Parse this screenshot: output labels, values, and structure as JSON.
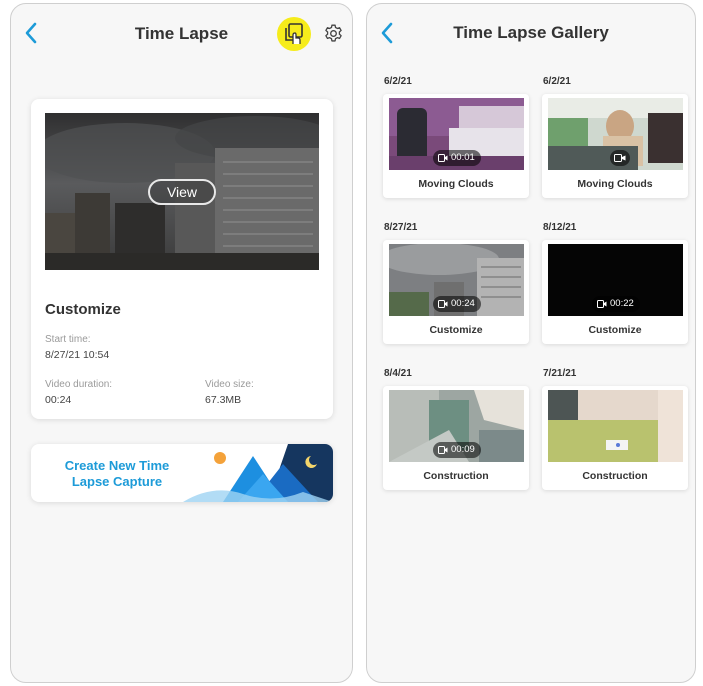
{
  "left_screen": {
    "title": "Time Lapse",
    "back_icon": "chevron-left-icon",
    "gallery_icon": "gallery-icon",
    "settings_icon": "gear-icon",
    "accent_color": "#1d9bd8",
    "highlight_color": "#f6ec1b",
    "card": {
      "view_label": "View",
      "title": "Customize",
      "start_time_label": "Start time:",
      "start_time_value": "8/27/21 10:54",
      "duration_label": "Video duration:",
      "duration_value": "00:24",
      "size_label": "Video size:",
      "size_value": "67.3MB"
    },
    "banner_label": "Create New Time Lapse Capture"
  },
  "right_screen": {
    "title": "Time Lapse Gallery",
    "back_icon": "chevron-left-icon",
    "items": [
      {
        "date": "6/2/21",
        "label": "Moving Clouds",
        "duration": "00:01"
      },
      {
        "date": "6/2/21",
        "label": "Moving Clouds",
        "duration": ""
      },
      {
        "date": "8/27/21",
        "label": "Customize",
        "duration": "00:24"
      },
      {
        "date": "8/12/21",
        "label": "Customize",
        "duration": "00:22"
      },
      {
        "date": "8/4/21",
        "label": "Construction",
        "duration": "00:09"
      },
      {
        "date": "7/21/21",
        "label": "Construction",
        "duration": ""
      }
    ]
  }
}
